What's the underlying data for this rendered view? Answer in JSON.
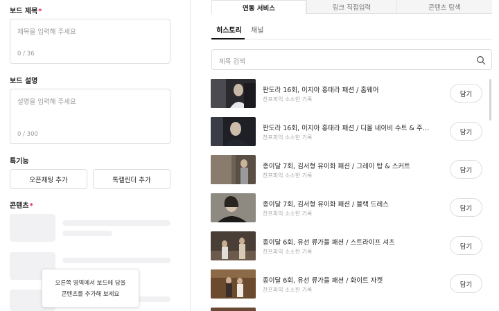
{
  "left_panel": {
    "board_title": {
      "label": "보드 제목",
      "required_mark": "*",
      "placeholder": "제목을 입력해 주세요",
      "counter": "0 / 36"
    },
    "board_desc": {
      "label": "보드 설명",
      "placeholder": "설명을 입력해 주세요",
      "counter": "0 / 300"
    },
    "features": {
      "label": "특기능",
      "buttons": [
        "오픈채팅 추가",
        "톡캘린더 추가"
      ]
    },
    "contents": {
      "label": "콘텐츠",
      "required_mark": "*"
    },
    "tooltip": {
      "line1": "오른쪽 영역에서 보드에 담을",
      "line2": "콘텐츠를 추가해 보세요"
    }
  },
  "right_panel": {
    "tabs": [
      "연동 서비스",
      "링크 직접입력",
      "콘텐츠 탐색"
    ],
    "active_tab": "연동 서비스",
    "subtabs": [
      "히스토리",
      "채널"
    ],
    "active_subtab": "히스토리",
    "search": {
      "placeholder": "제목 검색",
      "icon": "search-icon"
    },
    "add_label": "담기",
    "items": [
      {
        "title": "판도라 16회, 이지아 홍태라 패션 / 홈웨어",
        "source": "찬프피익 소소한 기록"
      },
      {
        "title": "판도라 16회, 이지아 홍태라 패션 / 디올 네이비 수트 & 주…",
        "source": "찬프피익 소소한 기록"
      },
      {
        "title": "종이달 7회, 김서형 유이화 패션 / 그레이 탑 & 스커트",
        "source": "찬프피익 소소한 기록"
      },
      {
        "title": "종이달 7회, 김서형 유이화 패션 / 블랙 드레스",
        "source": "찬프피익 소소한 기록"
      },
      {
        "title": "종이달 6회, 유선 류가을 패션 / 스트라이프 셔츠",
        "source": "찬프피익 소소한 기록"
      },
      {
        "title": "종이달 6회, 유선 류가을 패션 / 화이트 자켓",
        "source": "찬프피익 소소한 기록"
      }
    ]
  }
}
